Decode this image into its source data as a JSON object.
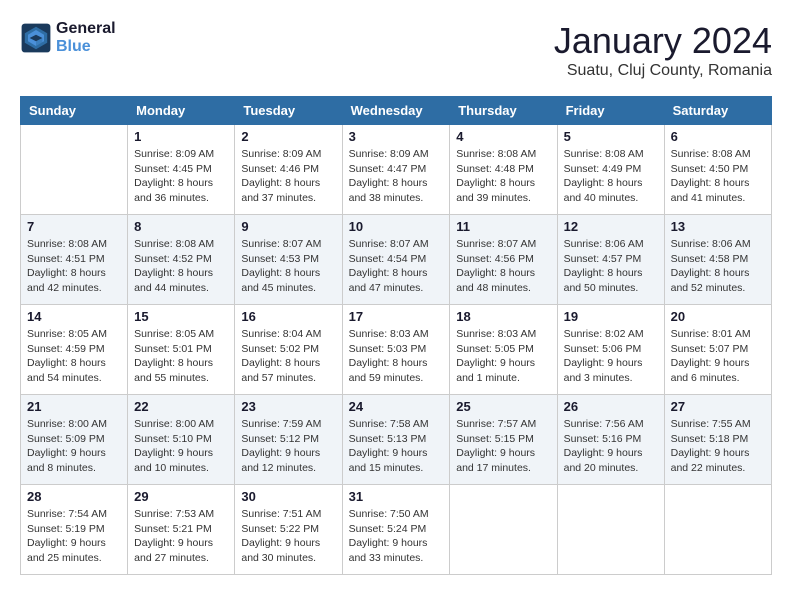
{
  "logo": {
    "line1": "General",
    "line2": "Blue"
  },
  "title": "January 2024",
  "location": "Suatu, Cluj County, Romania",
  "weekdays": [
    "Sunday",
    "Monday",
    "Tuesday",
    "Wednesday",
    "Thursday",
    "Friday",
    "Saturday"
  ],
  "weeks": [
    [
      {
        "day": "",
        "sunrise": "",
        "sunset": "",
        "daylight": ""
      },
      {
        "day": "1",
        "sunrise": "Sunrise: 8:09 AM",
        "sunset": "Sunset: 4:45 PM",
        "daylight": "Daylight: 8 hours and 36 minutes."
      },
      {
        "day": "2",
        "sunrise": "Sunrise: 8:09 AM",
        "sunset": "Sunset: 4:46 PM",
        "daylight": "Daylight: 8 hours and 37 minutes."
      },
      {
        "day": "3",
        "sunrise": "Sunrise: 8:09 AM",
        "sunset": "Sunset: 4:47 PM",
        "daylight": "Daylight: 8 hours and 38 minutes."
      },
      {
        "day": "4",
        "sunrise": "Sunrise: 8:08 AM",
        "sunset": "Sunset: 4:48 PM",
        "daylight": "Daylight: 8 hours and 39 minutes."
      },
      {
        "day": "5",
        "sunrise": "Sunrise: 8:08 AM",
        "sunset": "Sunset: 4:49 PM",
        "daylight": "Daylight: 8 hours and 40 minutes."
      },
      {
        "day": "6",
        "sunrise": "Sunrise: 8:08 AM",
        "sunset": "Sunset: 4:50 PM",
        "daylight": "Daylight: 8 hours and 41 minutes."
      }
    ],
    [
      {
        "day": "7",
        "sunrise": "Sunrise: 8:08 AM",
        "sunset": "Sunset: 4:51 PM",
        "daylight": "Daylight: 8 hours and 42 minutes."
      },
      {
        "day": "8",
        "sunrise": "Sunrise: 8:08 AM",
        "sunset": "Sunset: 4:52 PM",
        "daylight": "Daylight: 8 hours and 44 minutes."
      },
      {
        "day": "9",
        "sunrise": "Sunrise: 8:07 AM",
        "sunset": "Sunset: 4:53 PM",
        "daylight": "Daylight: 8 hours and 45 minutes."
      },
      {
        "day": "10",
        "sunrise": "Sunrise: 8:07 AM",
        "sunset": "Sunset: 4:54 PM",
        "daylight": "Daylight: 8 hours and 47 minutes."
      },
      {
        "day": "11",
        "sunrise": "Sunrise: 8:07 AM",
        "sunset": "Sunset: 4:56 PM",
        "daylight": "Daylight: 8 hours and 48 minutes."
      },
      {
        "day": "12",
        "sunrise": "Sunrise: 8:06 AM",
        "sunset": "Sunset: 4:57 PM",
        "daylight": "Daylight: 8 hours and 50 minutes."
      },
      {
        "day": "13",
        "sunrise": "Sunrise: 8:06 AM",
        "sunset": "Sunset: 4:58 PM",
        "daylight": "Daylight: 8 hours and 52 minutes."
      }
    ],
    [
      {
        "day": "14",
        "sunrise": "Sunrise: 8:05 AM",
        "sunset": "Sunset: 4:59 PM",
        "daylight": "Daylight: 8 hours and 54 minutes."
      },
      {
        "day": "15",
        "sunrise": "Sunrise: 8:05 AM",
        "sunset": "Sunset: 5:01 PM",
        "daylight": "Daylight: 8 hours and 55 minutes."
      },
      {
        "day": "16",
        "sunrise": "Sunrise: 8:04 AM",
        "sunset": "Sunset: 5:02 PM",
        "daylight": "Daylight: 8 hours and 57 minutes."
      },
      {
        "day": "17",
        "sunrise": "Sunrise: 8:03 AM",
        "sunset": "Sunset: 5:03 PM",
        "daylight": "Daylight: 8 hours and 59 minutes."
      },
      {
        "day": "18",
        "sunrise": "Sunrise: 8:03 AM",
        "sunset": "Sunset: 5:05 PM",
        "daylight": "Daylight: 9 hours and 1 minute."
      },
      {
        "day": "19",
        "sunrise": "Sunrise: 8:02 AM",
        "sunset": "Sunset: 5:06 PM",
        "daylight": "Daylight: 9 hours and 3 minutes."
      },
      {
        "day": "20",
        "sunrise": "Sunrise: 8:01 AM",
        "sunset": "Sunset: 5:07 PM",
        "daylight": "Daylight: 9 hours and 6 minutes."
      }
    ],
    [
      {
        "day": "21",
        "sunrise": "Sunrise: 8:00 AM",
        "sunset": "Sunset: 5:09 PM",
        "daylight": "Daylight: 9 hours and 8 minutes."
      },
      {
        "day": "22",
        "sunrise": "Sunrise: 8:00 AM",
        "sunset": "Sunset: 5:10 PM",
        "daylight": "Daylight: 9 hours and 10 minutes."
      },
      {
        "day": "23",
        "sunrise": "Sunrise: 7:59 AM",
        "sunset": "Sunset: 5:12 PM",
        "daylight": "Daylight: 9 hours and 12 minutes."
      },
      {
        "day": "24",
        "sunrise": "Sunrise: 7:58 AM",
        "sunset": "Sunset: 5:13 PM",
        "daylight": "Daylight: 9 hours and 15 minutes."
      },
      {
        "day": "25",
        "sunrise": "Sunrise: 7:57 AM",
        "sunset": "Sunset: 5:15 PM",
        "daylight": "Daylight: 9 hours and 17 minutes."
      },
      {
        "day": "26",
        "sunrise": "Sunrise: 7:56 AM",
        "sunset": "Sunset: 5:16 PM",
        "daylight": "Daylight: 9 hours and 20 minutes."
      },
      {
        "day": "27",
        "sunrise": "Sunrise: 7:55 AM",
        "sunset": "Sunset: 5:18 PM",
        "daylight": "Daylight: 9 hours and 22 minutes."
      }
    ],
    [
      {
        "day": "28",
        "sunrise": "Sunrise: 7:54 AM",
        "sunset": "Sunset: 5:19 PM",
        "daylight": "Daylight: 9 hours and 25 minutes."
      },
      {
        "day": "29",
        "sunrise": "Sunrise: 7:53 AM",
        "sunset": "Sunset: 5:21 PM",
        "daylight": "Daylight: 9 hours and 27 minutes."
      },
      {
        "day": "30",
        "sunrise": "Sunrise: 7:51 AM",
        "sunset": "Sunset: 5:22 PM",
        "daylight": "Daylight: 9 hours and 30 minutes."
      },
      {
        "day": "31",
        "sunrise": "Sunrise: 7:50 AM",
        "sunset": "Sunset: 5:24 PM",
        "daylight": "Daylight: 9 hours and 33 minutes."
      },
      {
        "day": "",
        "sunrise": "",
        "sunset": "",
        "daylight": ""
      },
      {
        "day": "",
        "sunrise": "",
        "sunset": "",
        "daylight": ""
      },
      {
        "day": "",
        "sunrise": "",
        "sunset": "",
        "daylight": ""
      }
    ]
  ]
}
